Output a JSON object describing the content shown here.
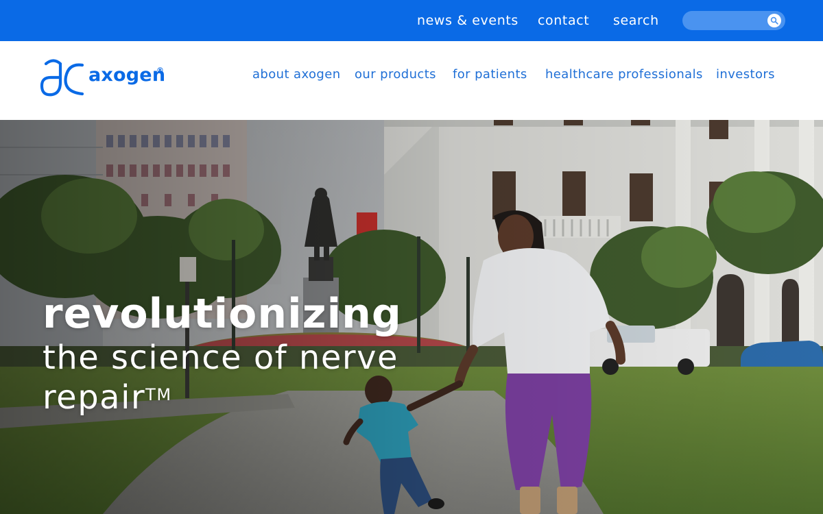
{
  "utility_bar": {
    "links": [
      "news & events",
      "contact",
      "search"
    ],
    "search_placeholder": "",
    "search_icon": "magnifier-icon",
    "background": "#0a6ae6"
  },
  "header": {
    "logo_text": "axogen",
    "logo_registered": "®",
    "nav": [
      "about axogen",
      "our products",
      "for patients",
      "healthcare professionals",
      "investors"
    ],
    "accent": "#1f6fd6"
  },
  "hero": {
    "headline": "revolutionizing",
    "subhead": "the science of nerve repair",
    "trademark": "TM"
  }
}
